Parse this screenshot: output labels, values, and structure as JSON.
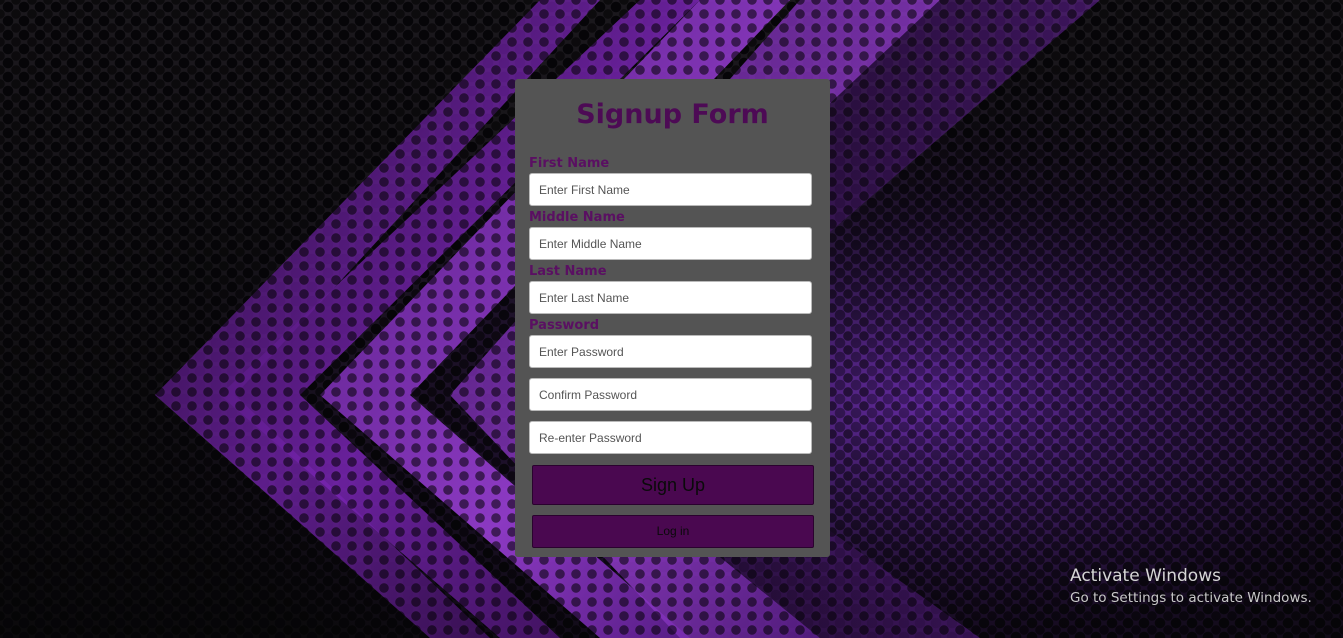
{
  "form": {
    "title": "Signup Form",
    "fields": [
      {
        "label": "First Name",
        "placeholder": "Enter First Name",
        "value": ""
      },
      {
        "label": "Middle Name",
        "placeholder": "Enter Middle Name",
        "value": ""
      },
      {
        "label": "Last Name",
        "placeholder": "Enter Last Name",
        "value": ""
      },
      {
        "label": "Password",
        "placeholder": "Enter Password",
        "value": ""
      }
    ],
    "confirm_placeholder": "Confirm Password",
    "reenter_placeholder": "Re-enter Password",
    "signup_label": "Sign Up",
    "login_label": "Log in"
  },
  "watermark": {
    "title": "Activate Windows",
    "subtitle": "Go to Settings to activate Windows."
  },
  "colors": {
    "card_bg": "#545454",
    "accent": "#4a0850",
    "label": "#5a0f62"
  }
}
